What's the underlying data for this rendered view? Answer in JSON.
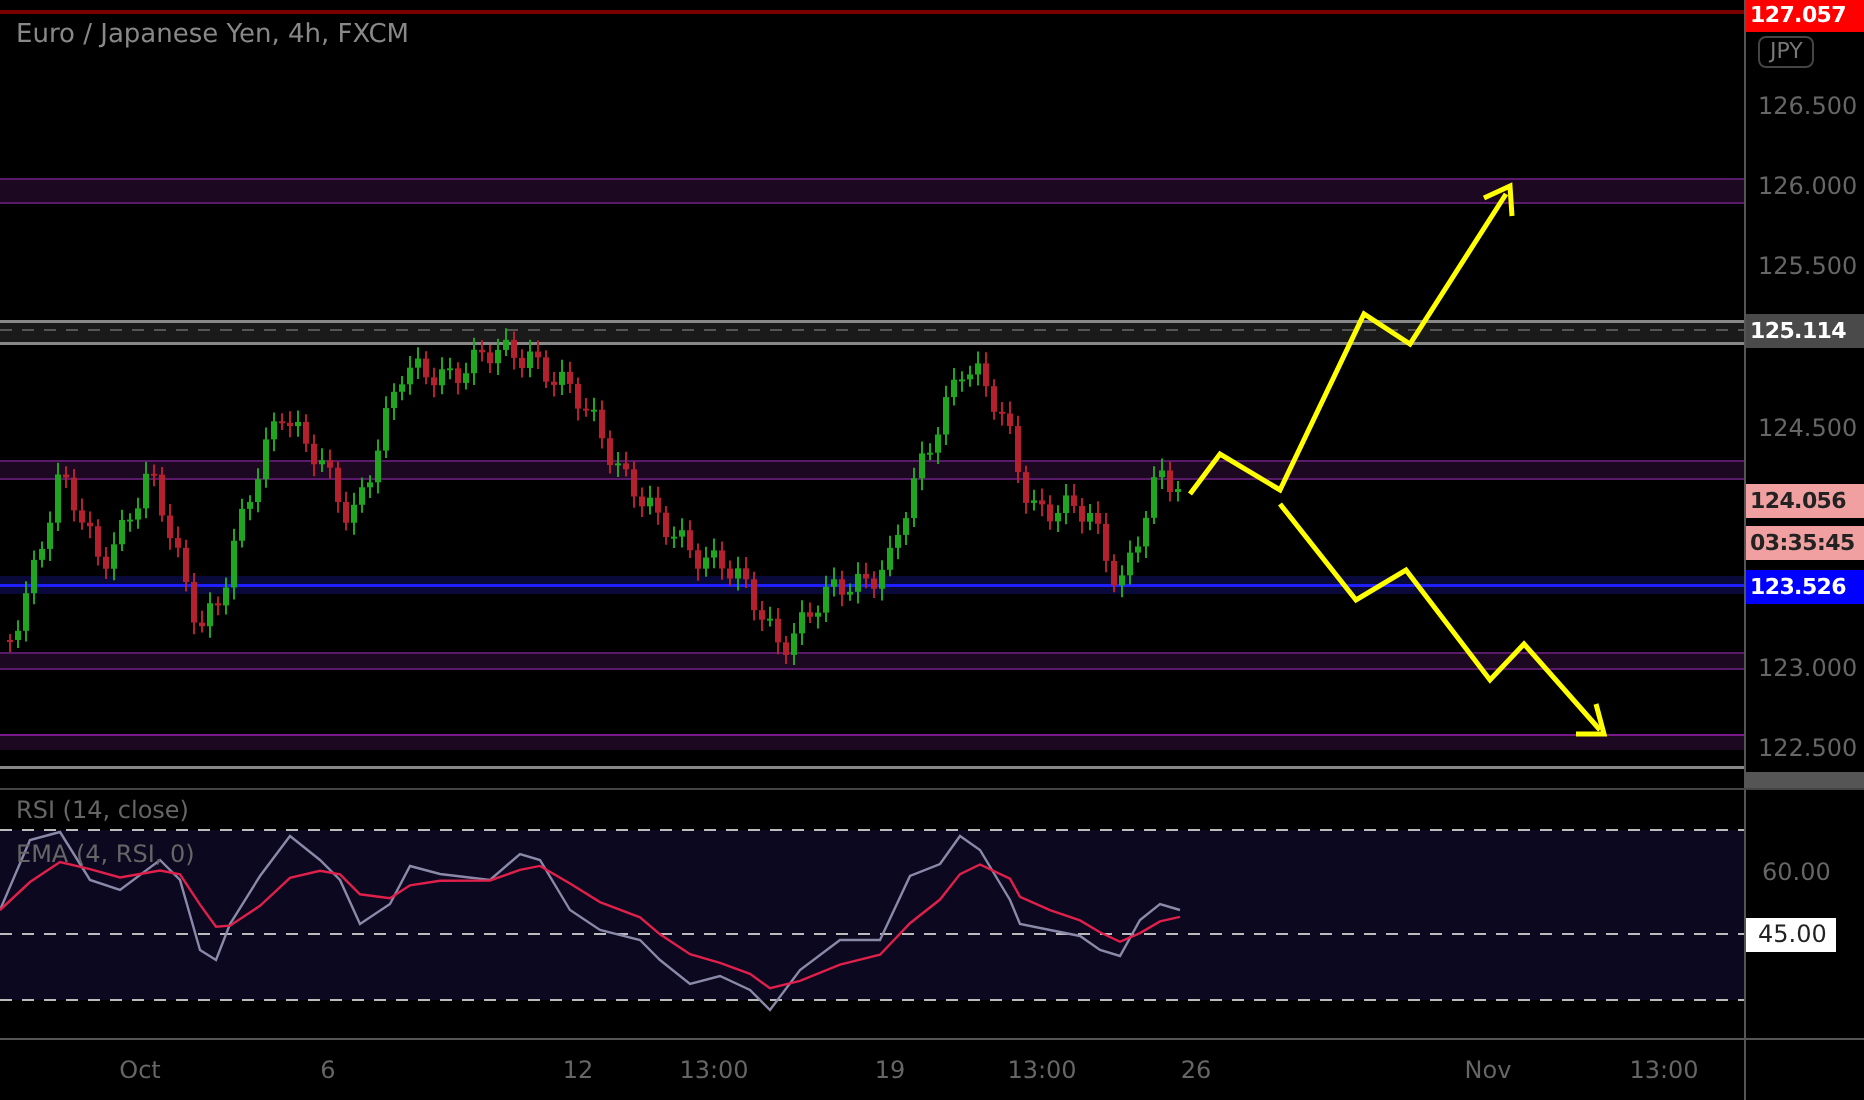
{
  "chart": {
    "title": "Euro / Japanese Yen, 4h, FXCM",
    "currency_button": "JPY",
    "price_axis": [
      "126.500",
      "126.000",
      "125.500",
      "124.500",
      "123.000",
      "122.500"
    ],
    "price_badges": [
      {
        "kind": "alert",
        "text": "127.057"
      },
      {
        "kind": "line",
        "text": "125.114"
      },
      {
        "kind": "last",
        "text": "124.056"
      },
      {
        "kind": "countdown",
        "text": "03:35:45"
      },
      {
        "kind": "level",
        "text": "123.526"
      }
    ]
  },
  "rsi": {
    "legend": [
      "RSI (14, close)",
      "EMA (4, RSI, 0)"
    ],
    "axis": [
      "60.00"
    ],
    "badge": "45.00"
  },
  "time_axis": [
    "Oct",
    "6",
    "12",
    "13:00",
    "19",
    "13:00",
    "26",
    "Nov",
    "13:00"
  ]
}
